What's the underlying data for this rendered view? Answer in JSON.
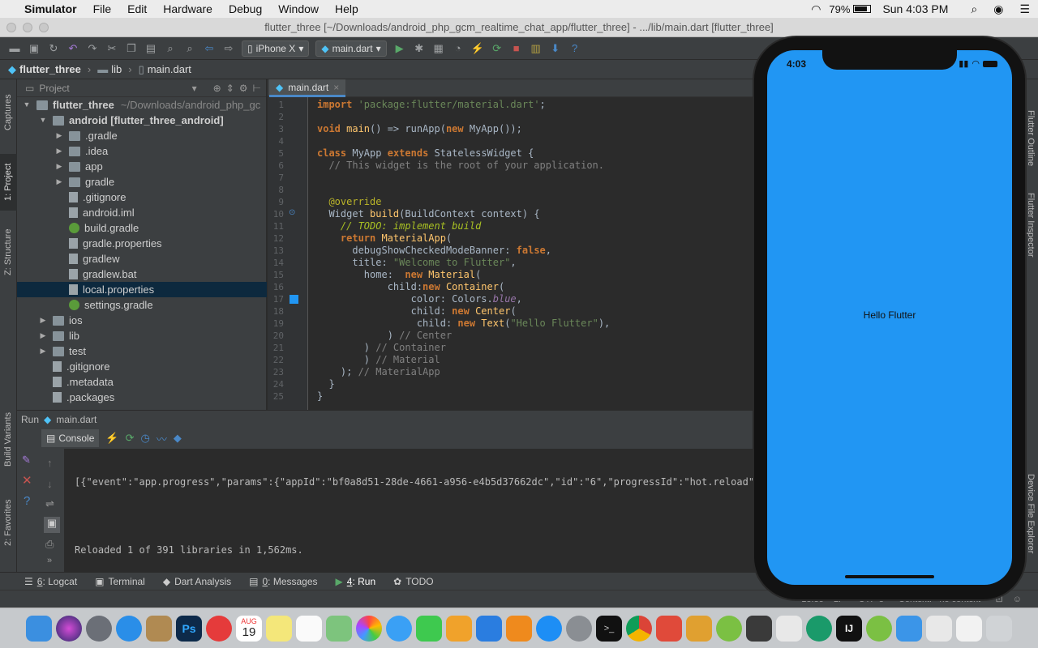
{
  "menubar": {
    "app": "Simulator",
    "items": [
      "File",
      "Edit",
      "Hardware",
      "Debug",
      "Window",
      "Help"
    ],
    "battery": "79%",
    "clock": "Sun 4:03 PM"
  },
  "window_title": "flutter_three [~/Downloads/android_php_gcm_realtime_chat_app/flutter_three] - .../lib/main.dart [flutter_three]",
  "toolbar": {
    "device": "iPhone X",
    "config": "main.dart"
  },
  "breadcrumb": [
    "flutter_three",
    "lib",
    "main.dart"
  ],
  "project": {
    "header": "Project",
    "tree": [
      {
        "label": "flutter_three",
        "extra": "~/Downloads/android_php_gc",
        "level": 0,
        "arrow": "▼",
        "icon": "folder",
        "bold": true
      },
      {
        "label": "android [flutter_three_android]",
        "level": 1,
        "arrow": "▼",
        "icon": "folder",
        "bold": true
      },
      {
        "label": ".gradle",
        "level": 2,
        "arrow": "▶",
        "icon": "folder"
      },
      {
        "label": ".idea",
        "level": 2,
        "arrow": "▶",
        "icon": "folder"
      },
      {
        "label": "app",
        "level": 2,
        "arrow": "▶",
        "icon": "folder"
      },
      {
        "label": "gradle",
        "level": 2,
        "arrow": "▶",
        "icon": "folder"
      },
      {
        "label": ".gitignore",
        "level": 2,
        "arrow": "",
        "icon": "file"
      },
      {
        "label": "android.iml",
        "level": 2,
        "arrow": "",
        "icon": "file"
      },
      {
        "label": "build.gradle",
        "level": 2,
        "arrow": "",
        "icon": "gradle"
      },
      {
        "label": "gradle.properties",
        "level": 2,
        "arrow": "",
        "icon": "file"
      },
      {
        "label": "gradlew",
        "level": 2,
        "arrow": "",
        "icon": "file"
      },
      {
        "label": "gradlew.bat",
        "level": 2,
        "arrow": "",
        "icon": "file"
      },
      {
        "label": "local.properties",
        "level": 2,
        "arrow": "",
        "icon": "file",
        "selected": true
      },
      {
        "label": "settings.gradle",
        "level": 2,
        "arrow": "",
        "icon": "gradle"
      },
      {
        "label": "ios",
        "level": 1,
        "arrow": "▶",
        "icon": "folder"
      },
      {
        "label": "lib",
        "level": 1,
        "arrow": "▶",
        "icon": "folder"
      },
      {
        "label": "test",
        "level": 1,
        "arrow": "▶",
        "icon": "folder"
      },
      {
        "label": ".gitignore",
        "level": 1,
        "arrow": "",
        "icon": "file"
      },
      {
        "label": ".metadata",
        "level": 1,
        "arrow": "",
        "icon": "file"
      },
      {
        "label": ".packages",
        "level": 1,
        "arrow": "",
        "icon": "file"
      }
    ]
  },
  "editor": {
    "tab": "main.dart",
    "lines": [
      [
        [
          "kw",
          "import "
        ],
        [
          "str",
          "'package:flutter/material.dart'"
        ],
        [
          "",
          "；"
        ]
      ],
      [],
      [
        [
          "kw",
          "void "
        ],
        [
          "fn",
          "main"
        ],
        [
          "",
          "() => runApp("
        ],
        [
          "kw",
          "new "
        ],
        [
          "",
          "MyApp());"
        ]
      ],
      [],
      [
        [
          "kw",
          "class "
        ],
        [
          "",
          "MyApp "
        ],
        [
          "kw",
          "extends "
        ],
        [
          "",
          "StatelessWidget {"
        ]
      ],
      [
        [
          "cm",
          "  // This widget is the root of your application."
        ]
      ],
      [],
      [],
      [
        [
          "an",
          "  @override"
        ]
      ],
      [
        [
          "",
          "  Widget "
        ],
        [
          "fn",
          "build"
        ],
        [
          "",
          "(BuildContext context) {"
        ]
      ],
      [
        [
          "todo",
          "    // TODO: implement build"
        ]
      ],
      [
        [
          "kw",
          "    return "
        ],
        [
          "fn",
          "MaterialApp"
        ],
        [
          "",
          "("
        ]
      ],
      [
        [
          "",
          "      debugShowCheckedModeBanner: "
        ],
        [
          "kw",
          "false"
        ],
        [
          "",
          ","
        ]
      ],
      [
        [
          "",
          "      title: "
        ],
        [
          "str",
          "\"Welcome to Flutter\""
        ],
        [
          "",
          ","
        ]
      ],
      [
        [
          "",
          "        home:  "
        ],
        [
          "kw",
          "new "
        ],
        [
          "fn",
          "Material"
        ],
        [
          "",
          "("
        ]
      ],
      [
        [
          "",
          "            child:"
        ],
        [
          "kw",
          "new "
        ],
        [
          "fn",
          "Container"
        ],
        [
          "",
          "("
        ]
      ],
      [
        [
          "",
          "                color: Colors."
        ],
        [
          "it",
          "blue"
        ],
        [
          "",
          ","
        ]
      ],
      [
        [
          "",
          "                child: "
        ],
        [
          "kw",
          "new "
        ],
        [
          "fn",
          "Center"
        ],
        [
          "",
          "("
        ]
      ],
      [
        [
          "",
          "                 child: "
        ],
        [
          "kw",
          "new "
        ],
        [
          "fn",
          "Text"
        ],
        [
          "",
          "("
        ],
        [
          "str",
          "\"Hello Flutter\""
        ],
        [
          "",
          "),"
        ]
      ],
      [
        [
          "",
          "            ) "
        ],
        [
          "cm",
          "// Center"
        ]
      ],
      [
        [
          "",
          "        ) "
        ],
        [
          "cm",
          "// Container"
        ]
      ],
      [
        [
          "",
          "        ) "
        ],
        [
          "cm",
          "// Material"
        ]
      ],
      [
        [
          "",
          "    ); "
        ],
        [
          "cm",
          "// MaterialApp"
        ]
      ],
      [
        [
          "",
          "  }"
        ]
      ],
      [
        [
          "",
          "}"
        ]
      ]
    ]
  },
  "run": {
    "label": "Run",
    "config": "main.dart",
    "console_tab": "Console",
    "output": [
      "[{\"event\":\"app.progress\",\"params\":{\"appId\":\"bf0a8d51-28de-4661-a956-e4b5d37662dc\",\"id\":\"6\",\"progressId\":\"hot.reload\",\"me",
      "",
      "Reloaded 1 of 391 libraries in 1,562ms."
    ]
  },
  "bottom_tabs": [
    {
      "num": "6",
      "label": ": Logcat"
    },
    {
      "num": "",
      "label": "Terminal"
    },
    {
      "num": "",
      "label": "Dart Analysis"
    },
    {
      "num": "0",
      "label": ": Messages"
    },
    {
      "num": "4",
      "label": ": Run",
      "active": true
    },
    {
      "num": "",
      "label": "TODO"
    }
  ],
  "left_tabs": [
    "Captures",
    "1: Project",
    "Z: Structure",
    "Build Variants",
    "2: Favorites"
  ],
  "right_tabs": [
    "Flutter Outline",
    "Flutter Inspector",
    "Device File Explorer"
  ],
  "status": {
    "position": "18:35",
    "line_sep": "LF÷",
    "encoding": "UTF-8÷",
    "context": "Context: <no context>"
  },
  "phone": {
    "time": "4:03",
    "text": "Hello Flutter",
    "bg": "#2196f3"
  },
  "dock_calendar": {
    "month": "AUG",
    "day": "19"
  }
}
